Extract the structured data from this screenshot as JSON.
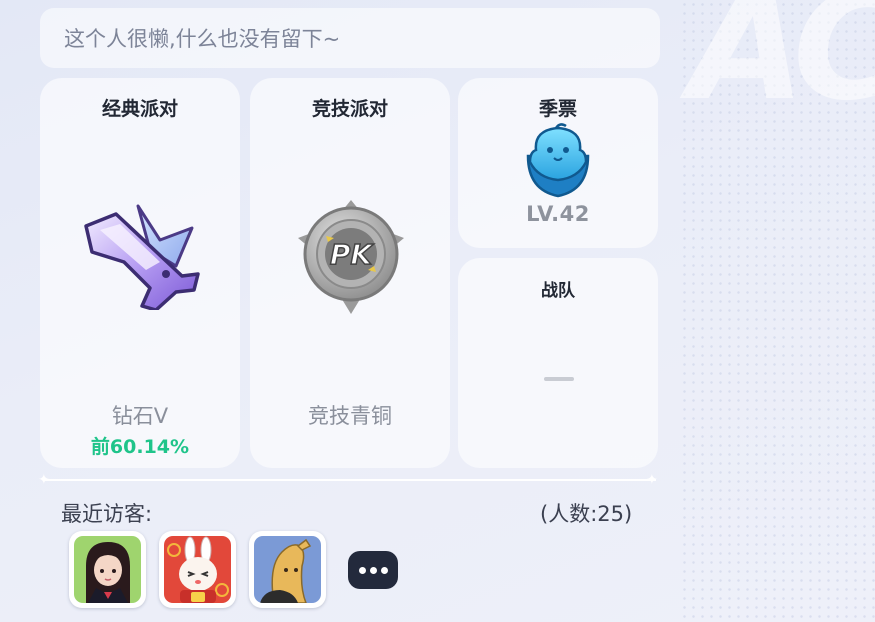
{
  "profile": {
    "signature": "这个人很懒,什么也没有留下~"
  },
  "cards": {
    "classic": {
      "title": "经典派对",
      "icon": "diamond-rank-gun-icon",
      "rank": "钻石V",
      "percentile": "前60.14%"
    },
    "ranked": {
      "title": "竞技派对",
      "icon": "pk-bronze-badge-icon",
      "rank": "竞技青铜"
    },
    "season": {
      "title": "季票",
      "icon": "season-pass-bird-badge-icon",
      "level": "LV.42"
    },
    "team": {
      "title": "战队",
      "value": "—"
    }
  },
  "visitors": {
    "label": "最近访客:",
    "count": "(人数:25)",
    "avatars": [
      {
        "icon": "girl-avatar-icon"
      },
      {
        "icon": "bunny-avatar-icon"
      },
      {
        "icon": "banana-avatar-icon"
      }
    ],
    "more_icon": "ellipsis-icon"
  },
  "colors": {
    "accent_green": "#1fc48a",
    "dark_button": "#232a3c"
  }
}
